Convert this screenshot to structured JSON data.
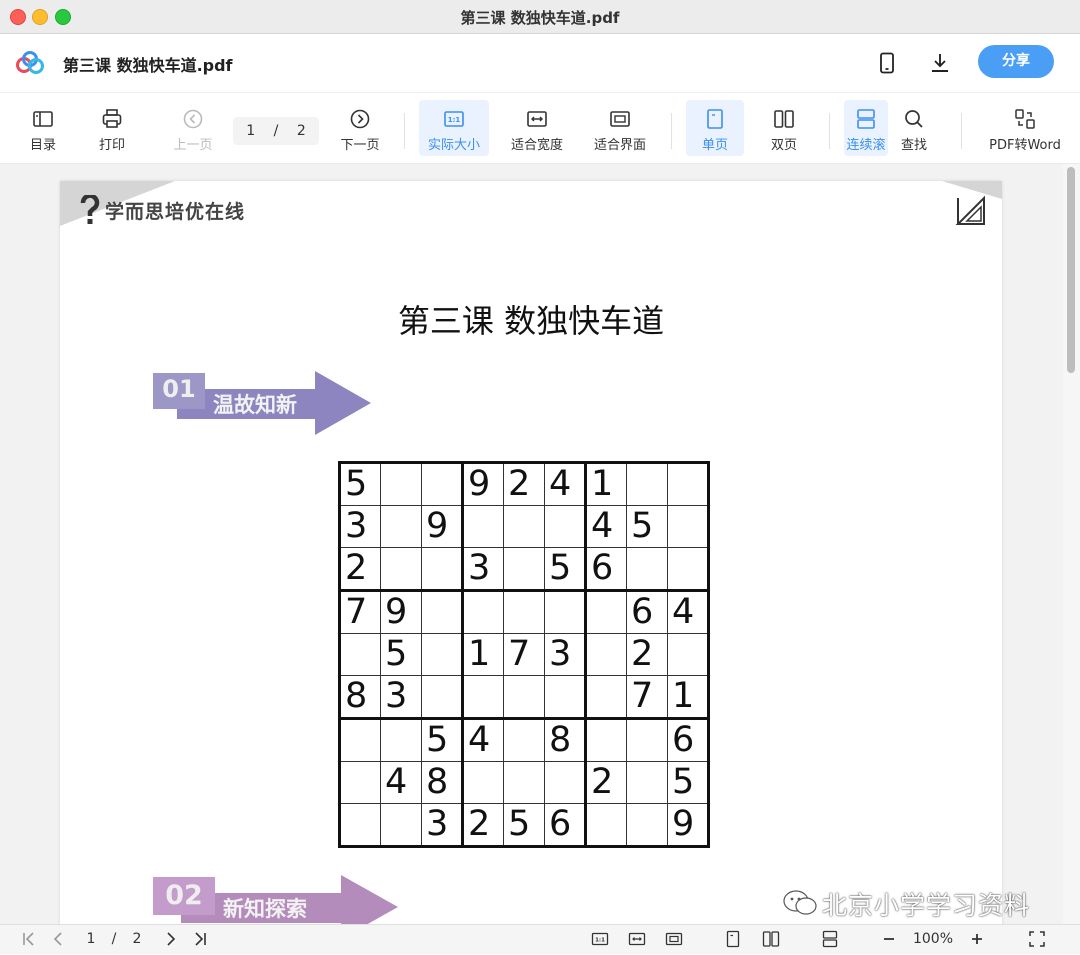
{
  "window": {
    "title": "第三课 数独快车道.pdf"
  },
  "appbar": {
    "doc_name": "第三课 数独快车道.pdf",
    "share_label": "分享"
  },
  "toolbar": {
    "toc": "目录",
    "print": "打印",
    "prev_page": "上一页",
    "page_current": "1",
    "page_sep": "/",
    "page_total": "2",
    "next_page": "下一页",
    "actual_size": "实际大小",
    "fit_width": "适合宽度",
    "fit_page": "适合界面",
    "single_page": "单页",
    "double_page": "双页",
    "continuous": "连续滚",
    "find": "查找",
    "pdf_to_word": "PDF转Word"
  },
  "document": {
    "brand": "学而思培优在线",
    "title": "第三课 数独快车道",
    "section1": {
      "num": "01",
      "label": "温故知新"
    },
    "section2": {
      "num": "02",
      "label": "新知探索"
    },
    "sudoku": [
      [
        "5",
        "",
        "",
        "9",
        "2",
        "4",
        "1",
        "",
        ""
      ],
      [
        "3",
        "",
        "9",
        "",
        "",
        "",
        "4",
        "5",
        ""
      ],
      [
        "2",
        "",
        "",
        "3",
        "",
        "5",
        "6",
        "",
        ""
      ],
      [
        "7",
        "9",
        "",
        "",
        "",
        "",
        "",
        "6",
        "4"
      ],
      [
        "",
        "5",
        "",
        "1",
        "7",
        "3",
        "",
        "2",
        ""
      ],
      [
        "8",
        "3",
        "",
        "",
        "",
        "",
        "",
        "7",
        "1"
      ],
      [
        "",
        "",
        "5",
        "4",
        "",
        "8",
        "",
        "",
        "6"
      ],
      [
        "",
        "4",
        "8",
        "",
        "",
        "",
        "2",
        "",
        "5"
      ],
      [
        "",
        "",
        "3",
        "2",
        "5",
        "6",
        "",
        "",
        "9"
      ]
    ]
  },
  "watermark": "北京小学学习资料",
  "statusbar": {
    "page_current": "1",
    "page_sep": "/",
    "page_total": "2",
    "zoom": "100%"
  },
  "colors": {
    "accent": "#4a9ef5",
    "banner1": "#8c85bf",
    "banner2": "#b48cbb"
  }
}
